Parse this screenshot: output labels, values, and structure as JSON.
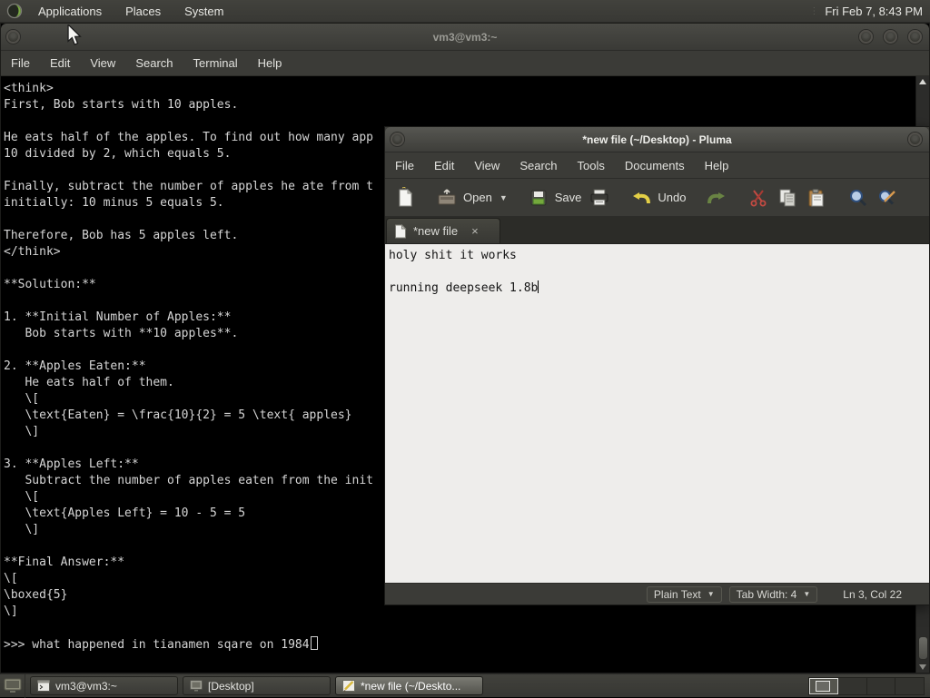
{
  "top_panel": {
    "menus": [
      "Applications",
      "Places",
      "System"
    ],
    "clock": "Fri Feb 7, 8:43 PM"
  },
  "terminal": {
    "title": "vm3@vm3:~",
    "menu": [
      "File",
      "Edit",
      "View",
      "Search",
      "Terminal",
      "Help"
    ],
    "lines": [
      "<think>",
      "First, Bob starts with 10 apples.",
      "",
      "He eats half of the apples. To find out how many app",
      "10 divided by 2, which equals 5.",
      "",
      "Finally, subtract the number of apples he ate from t",
      "initially: 10 minus 5 equals 5.",
      "",
      "Therefore, Bob has 5 apples left.",
      "</think>",
      "",
      "**Solution:**",
      "",
      "1. **Initial Number of Apples:**",
      "   Bob starts with **10 apples**.",
      "",
      "2. **Apples Eaten:**",
      "   He eats half of them.",
      "   \\[",
      "   \\text{Eaten} = \\frac{10}{2} = 5 \\text{ apples}",
      "   \\]",
      "",
      "3. **Apples Left:**",
      "   Subtract the number of apples eaten from the init",
      "   \\[",
      "   \\text{Apples Left} = 10 - 5 = 5",
      "   \\]",
      "",
      "**Final Answer:**",
      "\\[",
      "\\boxed{5}",
      "\\]",
      ""
    ],
    "prompt": ">>> what happened in tianamen sqare on 1984"
  },
  "pluma": {
    "title": "*new file (~/Desktop) - Pluma",
    "menu": [
      "File",
      "Edit",
      "View",
      "Search",
      "Tools",
      "Documents",
      "Help"
    ],
    "toolbar": {
      "open": "Open",
      "save": "Save",
      "undo": "Undo"
    },
    "tab": {
      "label": "*new file",
      "close": "×"
    },
    "editor_lines": [
      "holy shit it works",
      "",
      "running deepseek 1.8b"
    ],
    "status": {
      "language": "Plain Text",
      "tab_width": "Tab Width: 4",
      "position": "Ln 3, Col 22"
    }
  },
  "taskbar": {
    "buttons": [
      {
        "label": "vm3@vm3:~",
        "icon": "terminal-icon",
        "active": false
      },
      {
        "label": "[Desktop]",
        "icon": "desktop-icon",
        "active": false
      },
      {
        "label": "*new file (~/Deskto...",
        "icon": "pluma-icon",
        "active": true
      }
    ],
    "workspaces": 4,
    "active_workspace": 1
  },
  "colors": {
    "panel": "#3b3b37",
    "terminal_bg": "#000000",
    "terminal_fg": "#d6d6d6",
    "editor_bg": "#eeedeb",
    "titlebar_active_top": "#565651",
    "titlebar_inactive_top": "#4a4a45",
    "task_active_top": "#7b7b73"
  }
}
